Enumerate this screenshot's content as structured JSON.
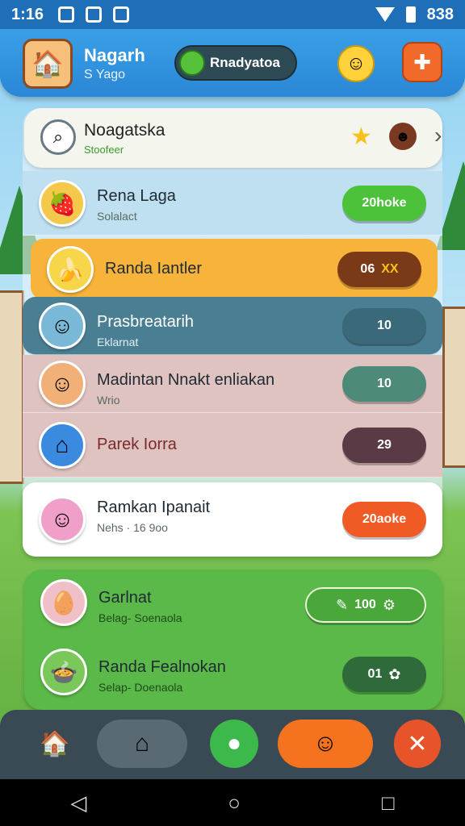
{
  "status_bar": {
    "time": "1:16",
    "right_text": "838"
  },
  "header": {
    "title": "Nagarh",
    "subtitle": "S Yago",
    "pill_label": "Rnadyatoa"
  },
  "top_card": {
    "title": "Noagatska",
    "subtitle": "Stoofeer"
  },
  "rows": [
    {
      "title": "Rena Laga",
      "subtitle": "Solalact",
      "button": "20hoke",
      "avatar_icon": "strawberry-icon",
      "bg": "#bfe0f0",
      "btn_color": "#4cc13a"
    },
    {
      "title": "Randa Iantler",
      "subtitle": "",
      "button": "06",
      "button2": "XX",
      "avatar_icon": "banana-icon",
      "bg": "#f7b33a",
      "btn_color": "#7a3a18"
    },
    {
      "title": "Prasbreatarih",
      "subtitle": "Eklarnat",
      "button": "10",
      "avatar_icon": "boy-icon",
      "bg": "#4a7f93",
      "btn_color": "#3a6a7a"
    },
    {
      "title": "Madintan Nnakt enliakan",
      "subtitle": "Wrio",
      "button": "10",
      "avatar_icon": "girl-icon",
      "bg": "#dfc3c0",
      "btn_color": "#4e8a7a"
    },
    {
      "title": "Parek Iorra",
      "subtitle": "",
      "button": "29",
      "avatar_icon": "house-icon",
      "bg": "#dfc3c0",
      "btn_color": "#5a3a44"
    },
    {
      "title": "Ramkan Ipanait",
      "subtitle": "Nehs · 16 9oo",
      "button": "20aoke",
      "avatar_icon": "child-icon",
      "bg": "#ffffff",
      "btn_color": "#f05a24"
    }
  ],
  "green_rows": [
    {
      "title": "Garlnat",
      "subtitle": "Belag- Soenaola",
      "button": "100"
    },
    {
      "title": "Randa Fealnokan",
      "subtitle": "Selap- Doenaola",
      "button": "01"
    }
  ],
  "colors": {
    "header": "#2a87d6",
    "green": "#5ab948",
    "bottom": "#3a4a55"
  }
}
